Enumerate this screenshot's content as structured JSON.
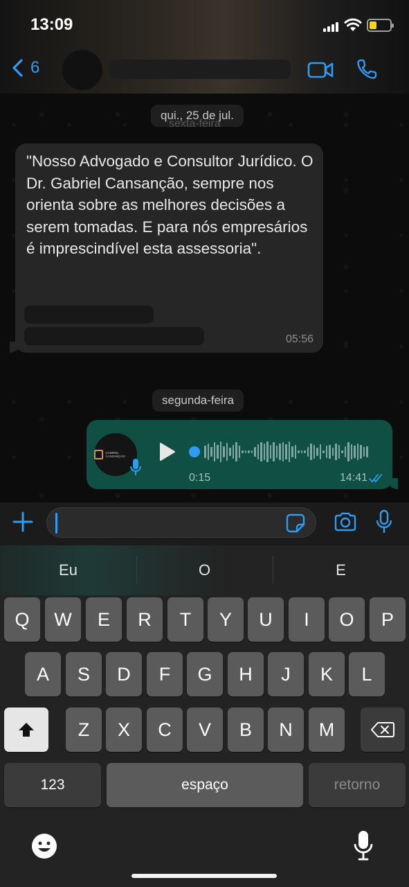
{
  "status_bar": {
    "time": "13:09"
  },
  "header": {
    "back_count": "6"
  },
  "chat": {
    "date_separator_1": "qui., 25 de jul.",
    "date_separator_1_ghost": "sexta-feira",
    "incoming_message": {
      "text": "\"Nosso Advogado e Consultor Jurídico. O Dr. Gabriel Cansanção, sempre nos orienta sobre as melhores decisões a serem tomadas. E para nós empresários é imprescindível esta assessoria\".",
      "time": "05:56"
    },
    "date_separator_2": "segunda-feira",
    "voice_message": {
      "duration": "0:15",
      "time": "14:41",
      "logo_text": "GABRIEL CANSANÇÃO",
      "progress": 0,
      "status": "read"
    }
  },
  "input_bar": {
    "value": "",
    "placeholder": ""
  },
  "keyboard": {
    "suggestions": [
      "Eu",
      "O",
      "E"
    ],
    "row1": [
      "Q",
      "W",
      "E",
      "R",
      "T",
      "Y",
      "U",
      "I",
      "O",
      "P"
    ],
    "row2": [
      "A",
      "S",
      "D",
      "F",
      "G",
      "H",
      "J",
      "K",
      "L"
    ],
    "row3": [
      "Z",
      "X",
      "C",
      "V",
      "B",
      "N",
      "M"
    ],
    "numbers_label": "123",
    "space_label": "espaço",
    "return_label": "retorno"
  },
  "colors": {
    "accent": "#2f9cf3",
    "outgoing_bubble": "#0f4f44",
    "incoming_bubble": "#262626",
    "battery": "#f7d51d"
  },
  "icons": [
    "back-chevron-icon",
    "video-call-icon",
    "phone-icon",
    "play-icon",
    "mic-icon",
    "plus-icon",
    "sticker-icon",
    "camera-icon",
    "shift-icon",
    "backspace-icon",
    "emoji-icon",
    "dictation-icon",
    "read-ticks-icon"
  ]
}
